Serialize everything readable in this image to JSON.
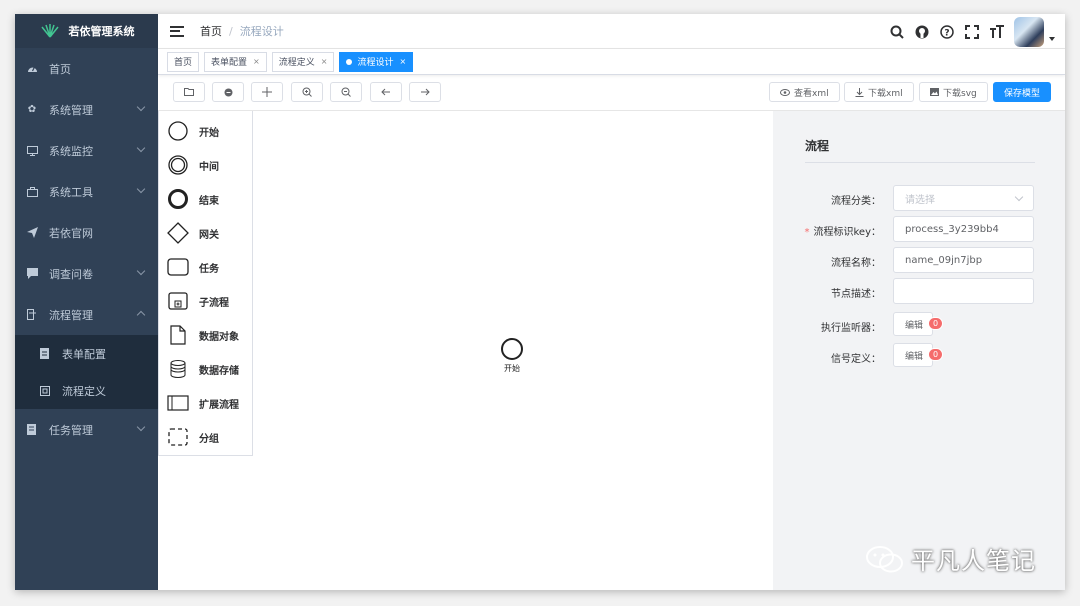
{
  "app": {
    "title": "若依管理系统"
  },
  "sidebar": {
    "items": [
      {
        "label": "首页",
        "icon": "dashboard-icon"
      },
      {
        "label": "系统管理",
        "icon": "gear-icon"
      },
      {
        "label": "系统监控",
        "icon": "monitor-icon"
      },
      {
        "label": "系统工具",
        "icon": "tool-icon"
      },
      {
        "label": "若依官网",
        "icon": "send-icon"
      },
      {
        "label": "调查问卷",
        "icon": "message-icon"
      },
      {
        "label": "流程管理",
        "icon": "flow-icon"
      },
      {
        "label": "任务管理",
        "icon": "task-icon"
      }
    ],
    "submenu": [
      {
        "label": "表单配置",
        "icon": "form-icon"
      },
      {
        "label": "流程定义",
        "icon": "definition-icon"
      }
    ]
  },
  "header": {
    "breadcrumb": {
      "home": "首页",
      "sep": "/",
      "current": "流程设计"
    }
  },
  "tags": [
    {
      "label": "首页"
    },
    {
      "label": "表单配置"
    },
    {
      "label": "流程定义"
    },
    {
      "label": "流程设计"
    }
  ],
  "toolbar": {
    "view_xml": "查看xml",
    "download_xml": "下载xml",
    "download_svg": "下载svg",
    "save_model": "保存模型"
  },
  "palette": [
    {
      "label": "开始",
      "icon": "start-event-icon"
    },
    {
      "label": "中间",
      "icon": "intermediate-event-icon"
    },
    {
      "label": "结束",
      "icon": "end-event-icon"
    },
    {
      "label": "网关",
      "icon": "gateway-icon"
    },
    {
      "label": "任务",
      "icon": "task-shape-icon"
    },
    {
      "label": "子流程",
      "icon": "subprocess-icon"
    },
    {
      "label": "数据对象",
      "icon": "data-object-icon"
    },
    {
      "label": "数据存储",
      "icon": "data-store-icon"
    },
    {
      "label": "扩展流程",
      "icon": "pool-icon"
    },
    {
      "label": "分组",
      "icon": "group-icon"
    }
  ],
  "canvas": {
    "start_label": "开始"
  },
  "properties": {
    "title": "流程",
    "category_label": "流程分类：",
    "category_placeholder": "请选择",
    "key_label": "流程标识key：",
    "key_value": "process_3y239bb4",
    "name_label": "流程名称：",
    "name_value": "name_09jn7jbp",
    "desc_label": "节点描述：",
    "listener_label": "执行监听器：",
    "listener_button": "编辑",
    "listener_count": "0",
    "signal_label": "信号定义：",
    "signal_button": "编辑",
    "signal_count": "0"
  },
  "watermark": {
    "text": "平凡人笔记"
  },
  "colors": {
    "sidebar_bg": "#304156",
    "primary": "#1890ff",
    "danger": "#f56c6c"
  }
}
